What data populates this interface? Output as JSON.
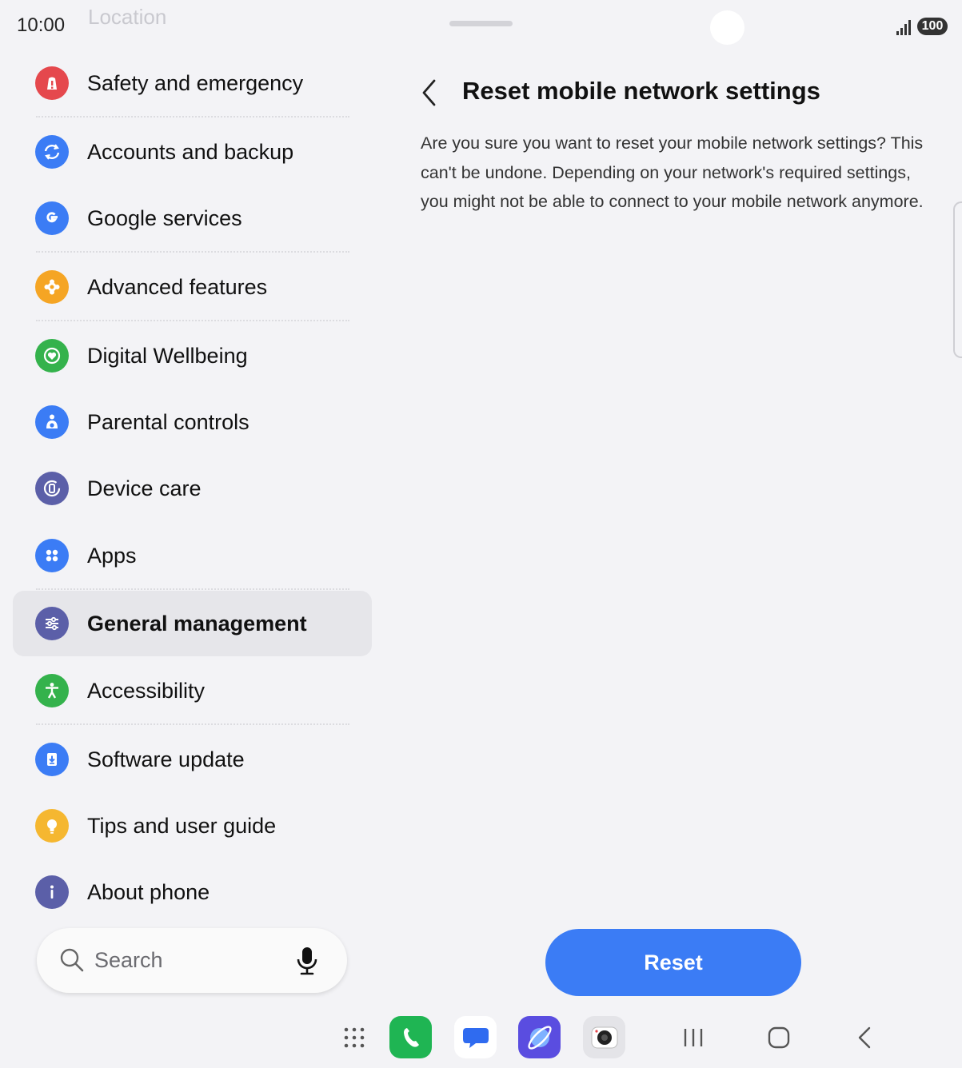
{
  "status_bar": {
    "time": "10:00",
    "faded_label": "Location",
    "battery": "100"
  },
  "menu": {
    "items": [
      {
        "label": "Safety and emergency",
        "icon": "alert-icon",
        "color": "#e5484d"
      },
      {
        "label": "Accounts and backup",
        "icon": "sync-icon",
        "color": "#3b7cf5"
      },
      {
        "label": "Google services",
        "icon": "google-icon",
        "color": "#3b7cf5"
      },
      {
        "label": "Advanced features",
        "icon": "puzzle-icon",
        "color": "#f5a524"
      },
      {
        "label": "Digital Wellbeing",
        "icon": "heart-icon",
        "color": "#34b24c"
      },
      {
        "label": "Parental controls",
        "icon": "child-icon",
        "color": "#3b7cf5"
      },
      {
        "label": "Device care",
        "icon": "device-care-icon",
        "color": "#5b5fa8"
      },
      {
        "label": "Apps",
        "icon": "apps-icon",
        "color": "#3b7cf5"
      },
      {
        "label": "General management",
        "icon": "sliders-icon",
        "color": "#5b5fa8",
        "selected": true
      },
      {
        "label": "Accessibility",
        "icon": "accessibility-icon",
        "color": "#34b24c"
      },
      {
        "label": "Software update",
        "icon": "update-icon",
        "color": "#3b7cf5"
      },
      {
        "label": "Tips and user guide",
        "icon": "lightbulb-icon",
        "color": "#f5b730"
      },
      {
        "label": "About phone",
        "icon": "info-icon",
        "color": "#5b5fa8"
      }
    ]
  },
  "search": {
    "placeholder": "Search"
  },
  "detail": {
    "title": "Reset mobile network settings",
    "description": "Are you sure you want to reset your mobile network settings? This can't be undone. Depending on your network's required settings, you might not be able to connect to your mobile network anymore.",
    "reset_label": "Reset"
  },
  "taskbar": {
    "apps": [
      "apps-grid-icon",
      "phone-icon",
      "messages-icon",
      "internet-icon",
      "camera-icon"
    ],
    "nav": [
      "recents-icon",
      "home-icon",
      "back-icon"
    ]
  },
  "colors": {
    "accent": "#3b7cf5",
    "background": "#f3f3f6",
    "selected_bg": "#e6e6ea"
  }
}
